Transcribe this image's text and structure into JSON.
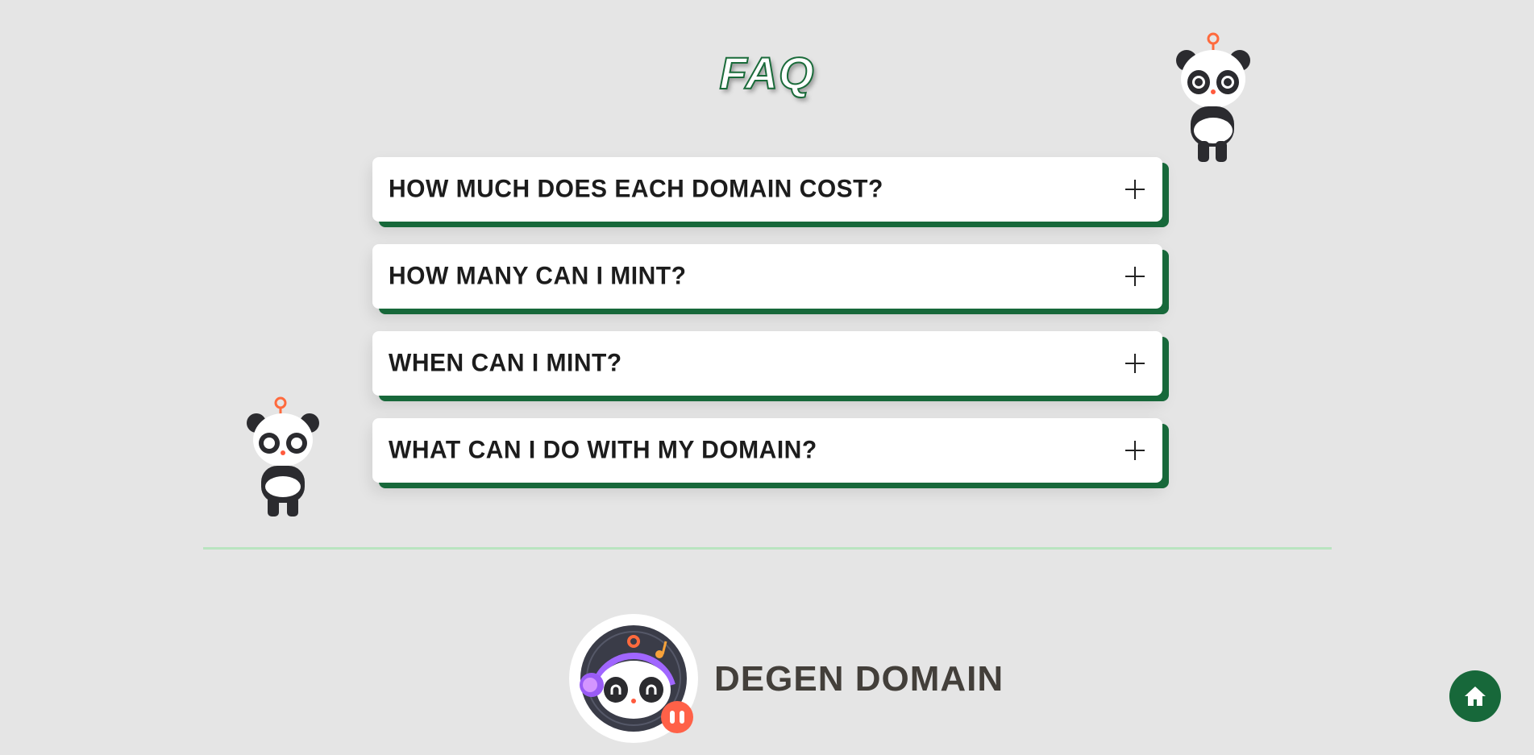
{
  "header": {
    "title": "FAQ"
  },
  "faq": {
    "items": [
      {
        "question": "How much does each domain cost?"
      },
      {
        "question": "How many can I mint?"
      },
      {
        "question": "When can I mint?"
      },
      {
        "question": "What can I do with my domain?"
      }
    ]
  },
  "footer": {
    "brand": "DEGEN DOMAIN"
  },
  "colors": {
    "accent": "#17683a",
    "background": "#e5e5e5",
    "divider": "#b9e4c0"
  },
  "icons": {
    "expand": "plus-icon",
    "home": "home-icon"
  }
}
